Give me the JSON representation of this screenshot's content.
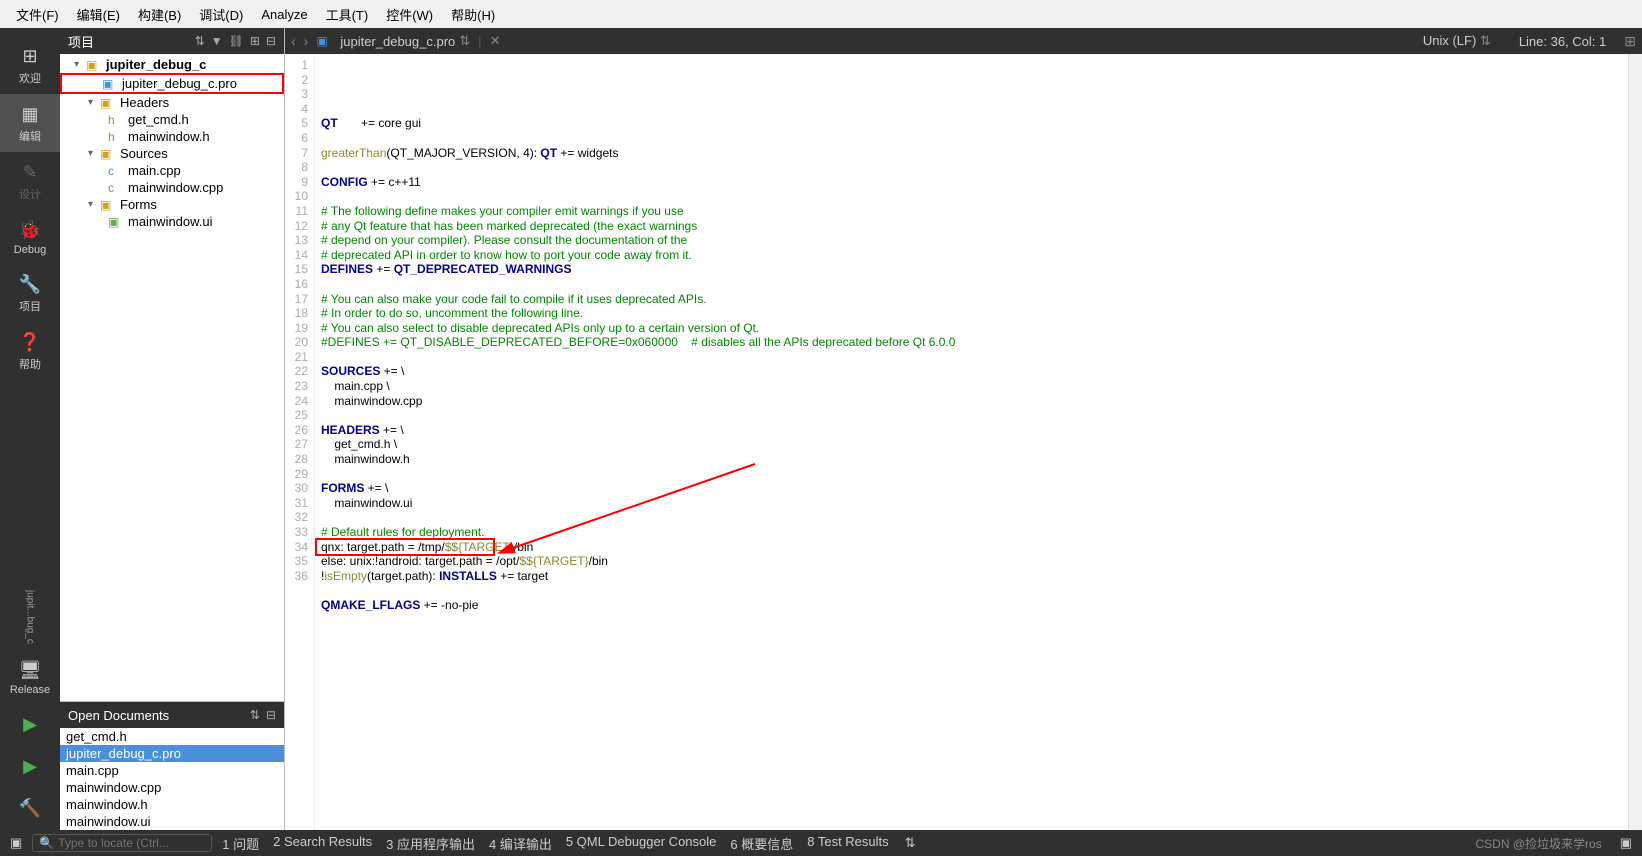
{
  "menubar": {
    "file": "文件(F)",
    "edit": "编辑(E)",
    "build": "构建(B)",
    "debug": "调试(D)",
    "analyze": "Analyze",
    "tools": "工具(T)",
    "widgets": "控件(W)",
    "help": "帮助(H)"
  },
  "leftRail": {
    "welcome": "欢迎",
    "edit": "编辑",
    "design": "设计",
    "debug": "Debug",
    "projects": "项目",
    "help": "帮助",
    "tab": "jupit...bug_c",
    "release": "Release"
  },
  "projectPanel": {
    "title": "项目",
    "tree": {
      "project": "jupiter_debug_c",
      "proFile": "jupiter_debug_c.pro",
      "headers": "Headers",
      "headerFiles": [
        "get_cmd.h",
        "mainwindow.h"
      ],
      "sources": "Sources",
      "sourceFiles": [
        "main.cpp",
        "mainwindow.cpp"
      ],
      "forms": "Forms",
      "formFiles": [
        "mainwindow.ui"
      ]
    }
  },
  "openDocs": {
    "title": "Open Documents",
    "items": [
      "get_cmd.h",
      "jupiter_debug_c.pro",
      "main.cpp",
      "mainwindow.cpp",
      "mainwindow.h",
      "mainwindow.ui"
    ],
    "selectedIndex": 1
  },
  "editor": {
    "fileName": "jupiter_debug_c.pro",
    "encoding": "Unix (LF)",
    "position": "Line: 36, Col: 1",
    "lines": [
      {
        "n": 1,
        "t": "QT       += core gui"
      },
      {
        "n": 2,
        "t": ""
      },
      {
        "n": 3,
        "t": "greaterThan(QT_MAJOR_VERSION, 4): QT += widgets"
      },
      {
        "n": 4,
        "t": ""
      },
      {
        "n": 5,
        "t": "CONFIG += c++11"
      },
      {
        "n": 6,
        "t": ""
      },
      {
        "n": 7,
        "t": "# The following define makes your compiler emit warnings if you use",
        "c": true
      },
      {
        "n": 8,
        "t": "# any Qt feature that has been marked deprecated (the exact warnings",
        "c": true
      },
      {
        "n": 9,
        "t": "# depend on your compiler). Please consult the documentation of the",
        "c": true
      },
      {
        "n": 10,
        "t": "# deprecated API in order to know how to port your code away from it.",
        "c": true
      },
      {
        "n": 11,
        "t": "DEFINES += QT_DEPRECATED_WARNINGS"
      },
      {
        "n": 12,
        "t": ""
      },
      {
        "n": 13,
        "t": "# You can also make your code fail to compile if it uses deprecated APIs.",
        "c": true
      },
      {
        "n": 14,
        "t": "# In order to do so, uncomment the following line.",
        "c": true
      },
      {
        "n": 15,
        "t": "# You can also select to disable deprecated APIs only up to a certain version of Qt.",
        "c": true
      },
      {
        "n": 16,
        "t": "#DEFINES += QT_DISABLE_DEPRECATED_BEFORE=0x060000    # disables all the APIs deprecated before Qt 6.0.0",
        "c": true
      },
      {
        "n": 17,
        "t": ""
      },
      {
        "n": 18,
        "t": "SOURCES += \\"
      },
      {
        "n": 19,
        "t": "    main.cpp \\"
      },
      {
        "n": 20,
        "t": "    mainwindow.cpp"
      },
      {
        "n": 21,
        "t": ""
      },
      {
        "n": 22,
        "t": "HEADERS += \\"
      },
      {
        "n": 23,
        "t": "    get_cmd.h \\"
      },
      {
        "n": 24,
        "t": "    mainwindow.h"
      },
      {
        "n": 25,
        "t": ""
      },
      {
        "n": 26,
        "t": "FORMS += \\"
      },
      {
        "n": 27,
        "t": "    mainwindow.ui"
      },
      {
        "n": 28,
        "t": ""
      },
      {
        "n": 29,
        "t": "# Default rules for deployment.",
        "c": true
      },
      {
        "n": 30,
        "t": "qnx: target.path = /tmp/$${TARGET}/bin"
      },
      {
        "n": 31,
        "t": "else: unix:!android: target.path = /opt/$${TARGET}/bin"
      },
      {
        "n": 32,
        "t": "!isEmpty(target.path): INSTALLS += target"
      },
      {
        "n": 33,
        "t": ""
      },
      {
        "n": 34,
        "t": "QMAKE_LFLAGS += -no-pie"
      },
      {
        "n": 35,
        "t": ""
      },
      {
        "n": 36,
        "t": ""
      }
    ]
  },
  "statusbar": {
    "searchPlaceholder": "Type to locate (Ctrl...",
    "tabs": [
      "1  问题",
      "2  Search Results",
      "3  应用程序输出",
      "4  编译输出",
      "5  QML Debugger Console",
      "6  概要信息",
      "8  Test Results"
    ],
    "watermark": "CSDN @捡垃圾来学ros"
  }
}
